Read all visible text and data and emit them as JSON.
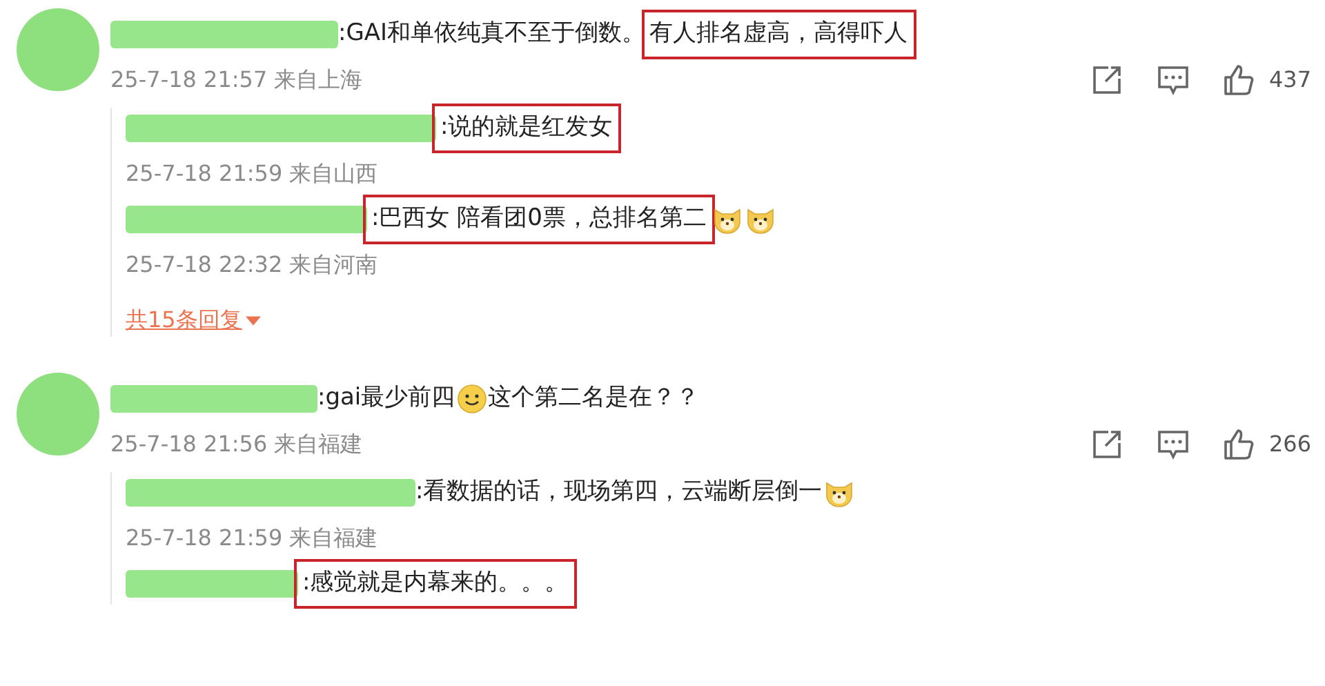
{
  "comments": [
    {
      "segments": [
        {
          "kind": "text",
          "text": ":GAI和单依纯真不至于倒数。",
          "highlighted": false
        },
        {
          "kind": "text",
          "text": "有人排名虚高，高得吓人",
          "highlighted": true
        }
      ],
      "meta": "25-7-18 21:57 来自上海",
      "likes": "437",
      "replies": [
        {
          "segments": [
            {
              "kind": "text",
              "text": ":说的就是红发女",
              "highlighted": true
            }
          ],
          "meta": "25-7-18 21:59 来自山西"
        },
        {
          "segments": [
            {
              "kind": "text",
              "text": ":巴西女 陪看团0票，总排名第二",
              "highlighted": true
            },
            {
              "kind": "dog"
            },
            {
              "kind": "dog"
            }
          ],
          "meta": "25-7-18 22:32 来自河南"
        }
      ],
      "more": "共15条回复"
    },
    {
      "segments": [
        {
          "kind": "text",
          "text": ":gai最少前四",
          "highlighted": false
        },
        {
          "kind": "smile"
        },
        {
          "kind": "text",
          "text": "这个第二名是在？？",
          "highlighted": false
        }
      ],
      "meta": "25-7-18 21:56 来自福建",
      "likes": "266",
      "replies": [
        {
          "segments": [
            {
              "kind": "text",
              "text": ":看数据的话，现场第四，云端断层倒一",
              "highlighted": false
            },
            {
              "kind": "dog"
            }
          ],
          "meta": "25-7-18 21:59 来自福建"
        },
        {
          "segments": [
            {
              "kind": "text",
              "text": ":感觉就是内幕来的。。。",
              "highlighted": true
            }
          ]
        }
      ]
    }
  ]
}
